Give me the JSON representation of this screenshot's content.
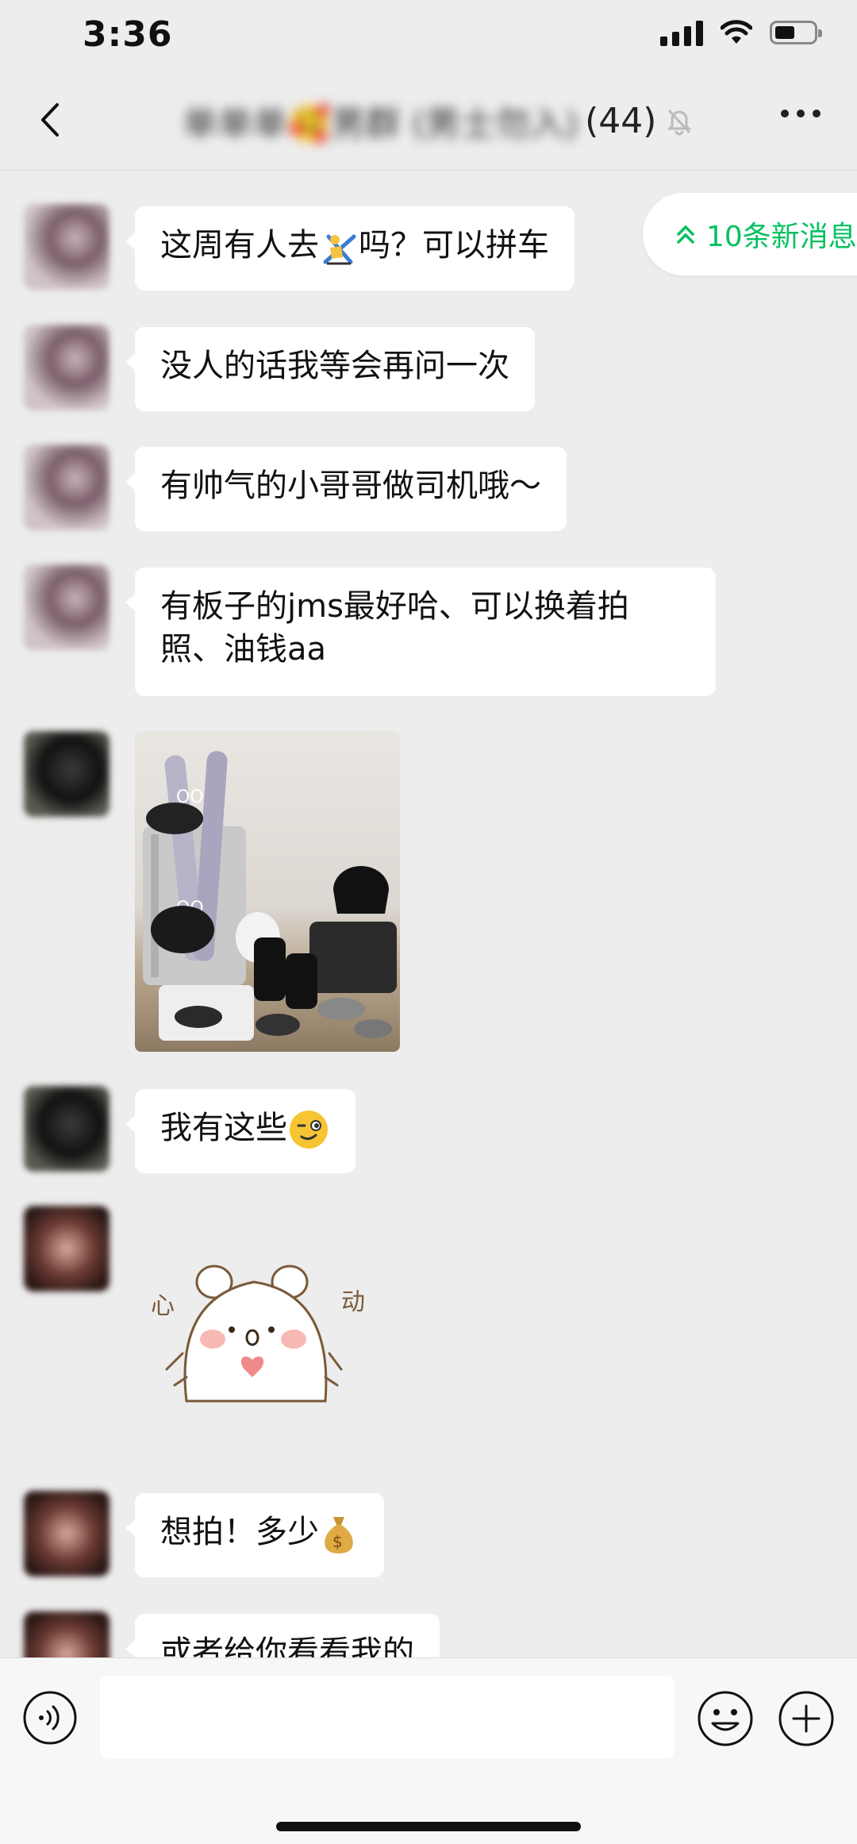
{
  "status": {
    "time": "3:36"
  },
  "nav": {
    "title_blurred": "单单单🥰男群 (男士勿入)",
    "member_count": "(44)"
  },
  "new_messages": {
    "label": "10条新消息",
    "accent": "#07c160"
  },
  "messages": [
    {
      "text_before": "这周有人去",
      "icon": "skier-emoji",
      "text_after": "吗？可以拼车"
    },
    {
      "text": "没人的话我等会再问一次"
    },
    {
      "text": "有帅气的小哥哥做司机哦～"
    },
    {
      "line1": "有板子的jms最好哈、可以换着拍",
      "line2": "照、油钱aa"
    },
    {
      "type": "image",
      "icon": "ski-gear-photo"
    },
    {
      "text": "我有这些",
      "icon": "wink-emoji"
    },
    {
      "type": "sticker",
      "left_text": "心",
      "right_text": "动"
    },
    {
      "text": "想拍！多少",
      "icon": "money-bag-emoji"
    },
    {
      "text": "或者给你看看我的"
    }
  ],
  "input": {
    "placeholder": ""
  }
}
